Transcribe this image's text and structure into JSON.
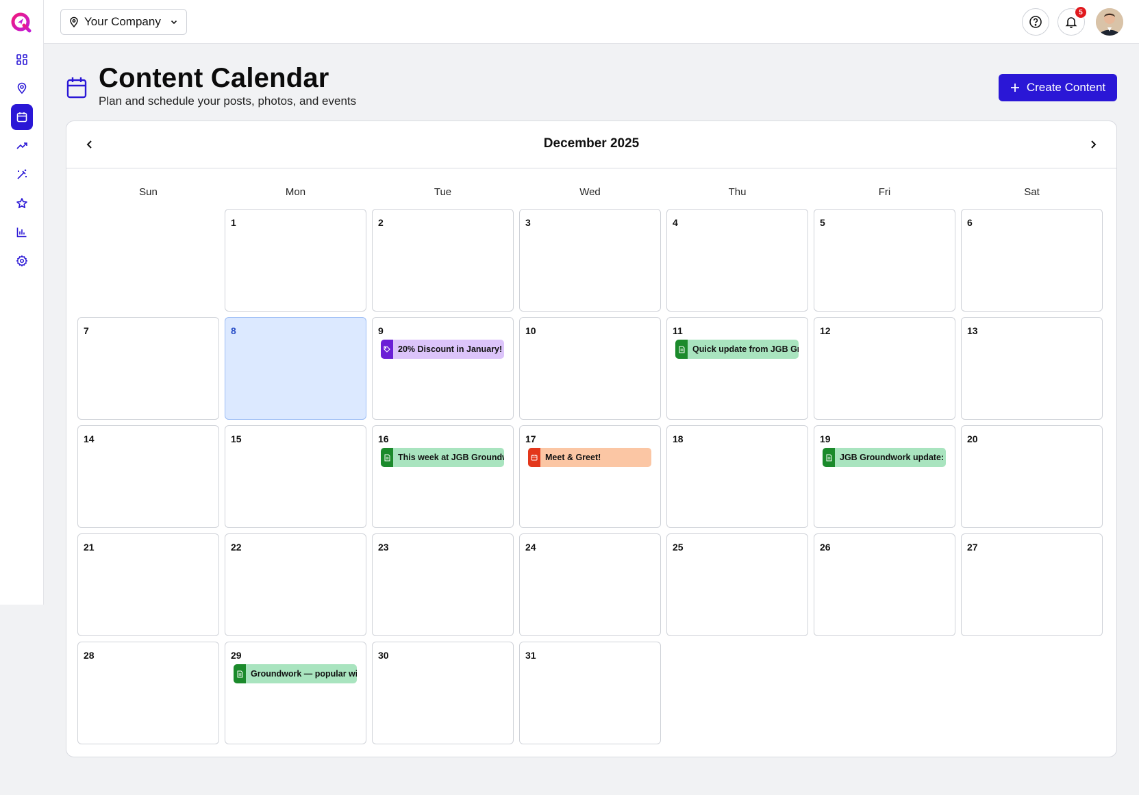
{
  "colors": {
    "accent": "#2a17d6",
    "offer": "#dcc4fa",
    "post": "#a9e4bf",
    "event": "#fbc6a4",
    "badge": "#e0191e"
  },
  "sidebar": {
    "items": [
      {
        "name": "dashboard",
        "icon": "grid-icon"
      },
      {
        "name": "locations",
        "icon": "map-pin-icon"
      },
      {
        "name": "calendar",
        "icon": "calendar-icon",
        "active": true
      },
      {
        "name": "trends",
        "icon": "trending-up-icon"
      },
      {
        "name": "magic",
        "icon": "magic-wand-icon"
      },
      {
        "name": "reviews",
        "icon": "star-icon"
      },
      {
        "name": "reports",
        "icon": "bar-chart-icon"
      },
      {
        "name": "settings",
        "icon": "gear-icon"
      }
    ]
  },
  "topbar": {
    "company": "Your Company",
    "notification_count": "5"
  },
  "header": {
    "title": "Content Calendar",
    "subtitle": "Plan and schedule your posts, photos, and events",
    "create_label": "Create Content"
  },
  "calendar": {
    "month": "December 2025",
    "weekdays": [
      "Sun",
      "Mon",
      "Tue",
      "Wed",
      "Thu",
      "Fri",
      "Sat"
    ],
    "today": 8,
    "days": [
      "1",
      "2",
      "3",
      "4",
      "5",
      "6",
      "7",
      "8",
      "9",
      "10",
      "11",
      "12",
      "13",
      "14",
      "15",
      "16",
      "17",
      "18",
      "19",
      "20",
      "21",
      "22",
      "23",
      "24",
      "25",
      "26",
      "27",
      "28",
      "29",
      "30",
      "31"
    ],
    "events": [
      {
        "day": 9,
        "type": "offer",
        "icon": "tag-icon",
        "text": "20% Discount in January!"
      },
      {
        "day": 11,
        "type": "post",
        "icon": "document-icon",
        "text": "Quick update from JGB Groundwork"
      },
      {
        "day": 16,
        "type": "post",
        "icon": "document-icon",
        "text": "This week at JGB Groundwork"
      },
      {
        "day": 17,
        "type": "event",
        "icon": "calendar-icon",
        "text": "Meet & Greet!"
      },
      {
        "day": 19,
        "type": "post",
        "icon": "document-icon",
        "text": "JGB Groundwork update: we"
      },
      {
        "day": 29,
        "type": "post",
        "icon": "document-icon",
        "text": "Groundwork — popular with"
      }
    ]
  }
}
